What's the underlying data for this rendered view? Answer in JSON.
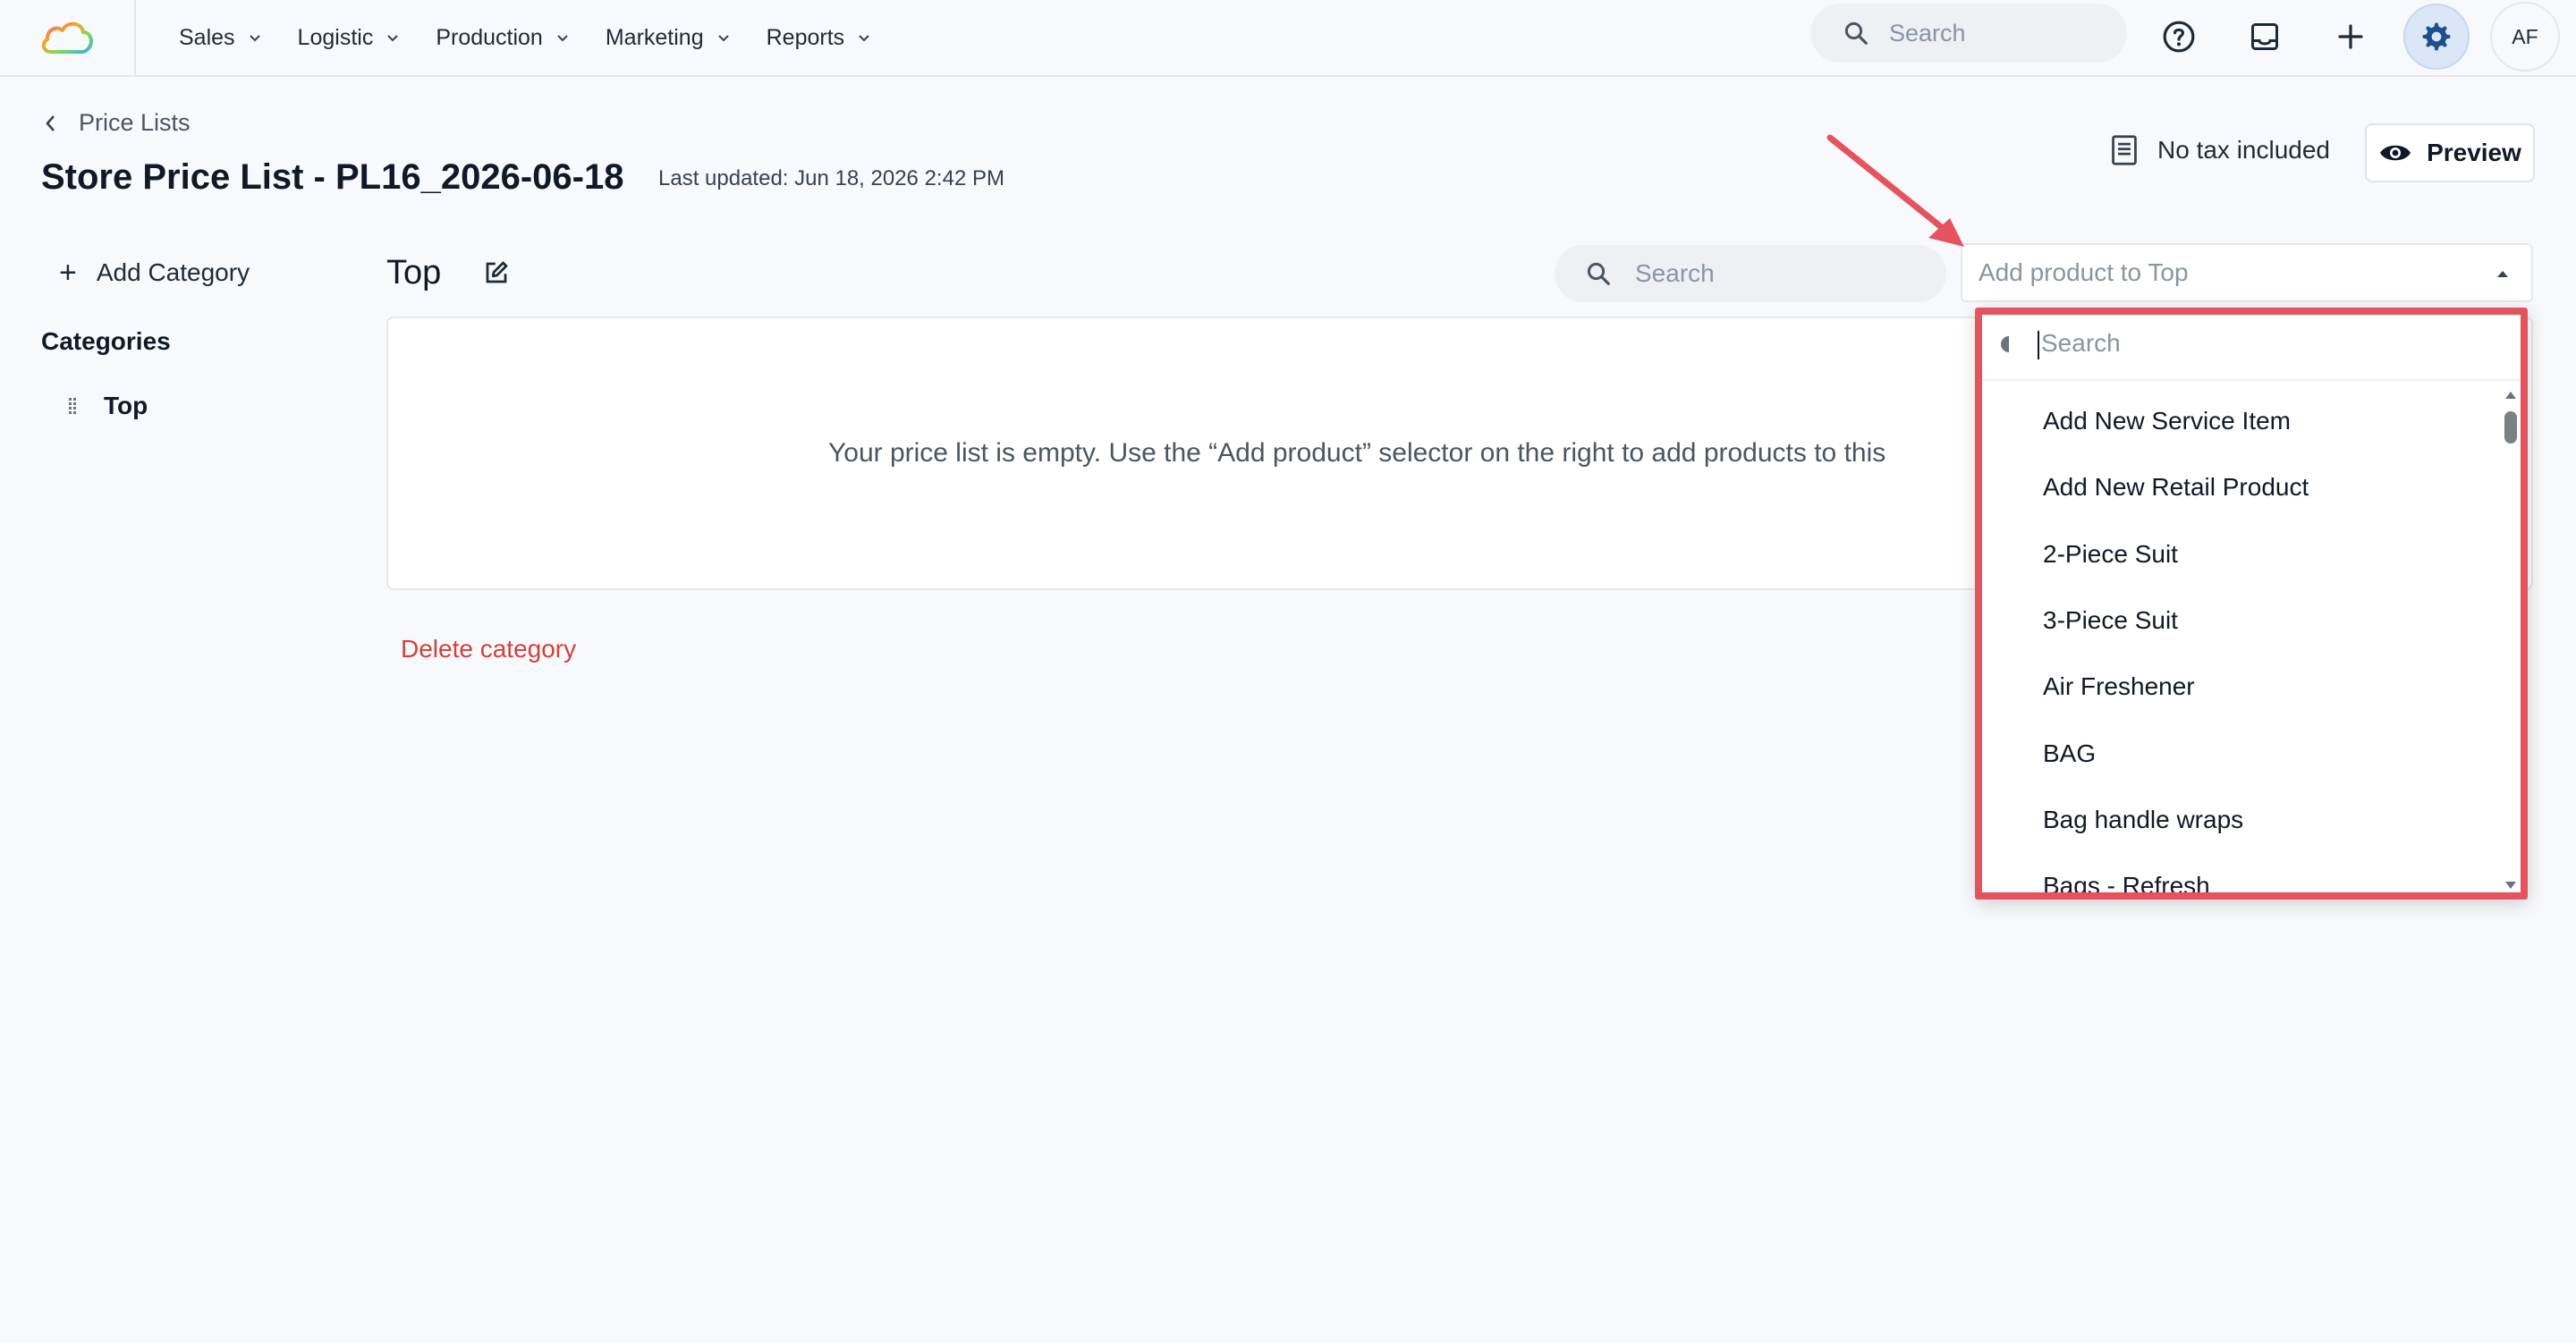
{
  "nav": {
    "menu": [
      {
        "label": "Sales"
      },
      {
        "label": "Logistic"
      },
      {
        "label": "Production"
      },
      {
        "label": "Marketing"
      },
      {
        "label": "Reports"
      }
    ],
    "search_placeholder": "Search",
    "avatar_initials": "AF",
    "settings_active_color": "#dbe7f7"
  },
  "header": {
    "breadcrumb": "Price Lists",
    "title": "Store Price List - PL16_2026-06-18",
    "last_updated": "Last updated: Jun 18, 2026 2:42 PM",
    "tax_label": "No tax included",
    "preview_label": "Preview"
  },
  "sidebar": {
    "add_category_label": "Add Category",
    "categories_heading": "Categories",
    "items": [
      {
        "label": "Top"
      }
    ]
  },
  "main": {
    "category_title": "Top",
    "search_placeholder": "Search",
    "add_product_placeholder": "Add product to Top",
    "empty_message": "Your price list is empty. Use the “Add product” selector on the right to add products to this",
    "delete_category_label": "Delete category"
  },
  "dropdown": {
    "search_placeholder": "Search",
    "options": [
      "Add New Service Item",
      "Add New Retail Product",
      "2-Piece Suit",
      "3-Piece Suit",
      "Air Freshener",
      "BAG",
      "Bag handle wraps",
      "Bags - Refresh"
    ]
  },
  "annotation": {
    "highlight_color": "#e5535f"
  }
}
